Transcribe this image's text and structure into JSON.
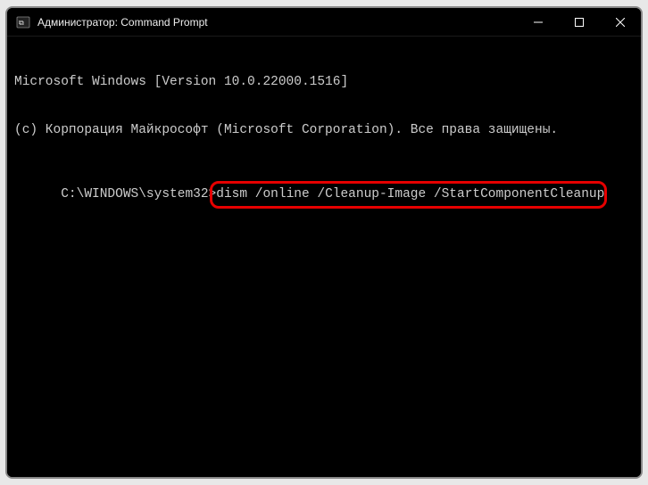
{
  "window": {
    "title": "Администратор: Command Prompt"
  },
  "terminal": {
    "line1": "Microsoft Windows [Version 10.0.22000.1516]",
    "line2": "(c) Корпорация Майкрософт (Microsoft Corporation). Все права защищены.",
    "blank": "",
    "prompt": "C:\\WINDOWS\\system32>",
    "command": "dism /online /Cleanup-Image /StartComponentCleanup"
  },
  "icons": {
    "app": "cmd-icon",
    "minimize": "minimize-icon",
    "maximize": "maximize-icon",
    "close": "close-icon"
  }
}
